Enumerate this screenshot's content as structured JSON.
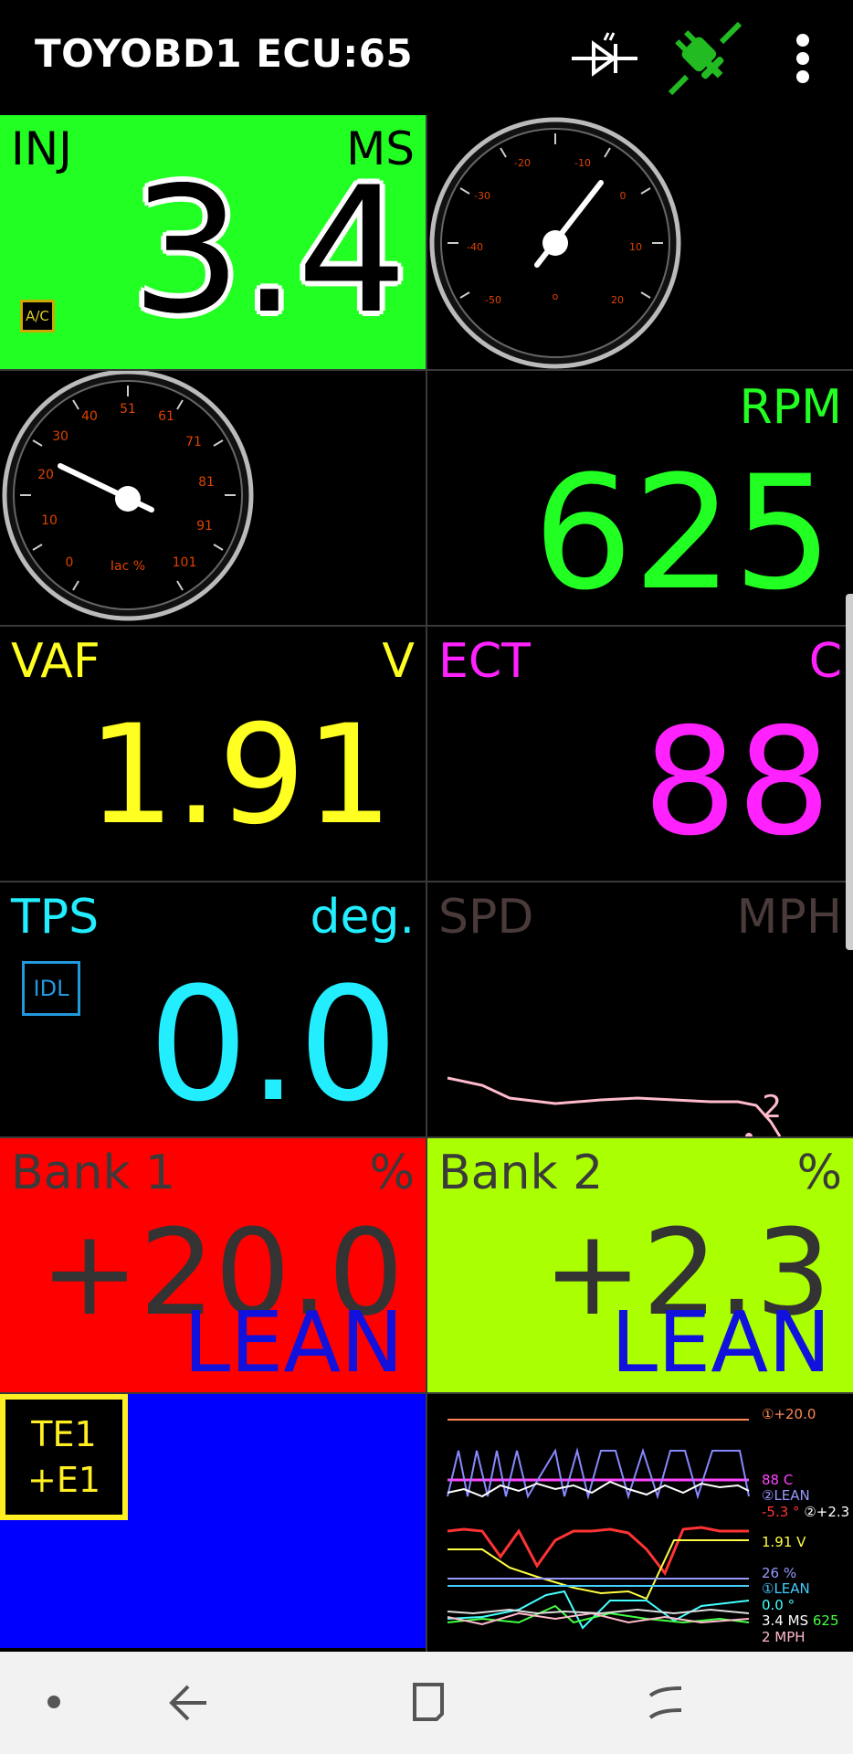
{
  "app": {
    "title": "TOYOBD1 ECU:65"
  },
  "toolbar": {
    "icons": [
      "diode-icon",
      "plug-connected-icon",
      "more-vert-icon"
    ]
  },
  "inj": {
    "label": "INJ",
    "unit": "MS",
    "value": "3.4",
    "badge": "A/C"
  },
  "gauge_ign": {
    "ticks": [
      "-20",
      "-10",
      "0",
      "10",
      "20",
      "-30",
      "-40",
      "-50"
    ],
    "center_mark": "o"
  },
  "gauge_iac": {
    "ticks": [
      "0",
      "10",
      "20",
      "30",
      "40",
      "51",
      "61",
      "71",
      "81",
      "91",
      "101"
    ],
    "label": "Iac %"
  },
  "rpm": {
    "label": "RPM",
    "value": "625"
  },
  "vaf": {
    "label": "VAF",
    "unit": "V",
    "value": "1.91"
  },
  "ect": {
    "label": "ECT",
    "unit": "C",
    "value": "88"
  },
  "tps": {
    "label": "TPS",
    "unit": "deg.",
    "value": "0.0",
    "badge": "IDL"
  },
  "spd": {
    "label": "SPD",
    "unit": "MPH",
    "value": "2"
  },
  "bank1": {
    "label": "Bank 1",
    "unit": "%",
    "value": "+20.0",
    "status": "LEAN"
  },
  "bank2": {
    "label": "Bank 2",
    "unit": "%",
    "value": "+2.3",
    "status": "LEAN"
  },
  "te1": {
    "line1": "TE1",
    "line2": "+E1"
  },
  "legend": {
    "items": [
      {
        "text": "①+20.0",
        "color": "#ff8855"
      },
      {
        "text": "88  C",
        "color": "#ff44ff"
      },
      {
        "text": "②LEAN",
        "color": "#9999ff"
      },
      {
        "text": "-5.3 °",
        "color": "#ff3333"
      },
      {
        "text": "②+2.3",
        "color": "#ffffff"
      },
      {
        "text": "1.91  V",
        "color": "#ffff44"
      },
      {
        "text": "26 %",
        "color": "#9999ff"
      },
      {
        "text": "①LEAN",
        "color": "#44ccff"
      },
      {
        "text": "0.0 °",
        "color": "#44ffff"
      },
      {
        "text": "3.4 MS",
        "color": "#ffffff"
      },
      {
        "text": "625",
        "color": "#44ff44"
      },
      {
        "text": "2  MPH",
        "color": "#ffbbcc"
      }
    ]
  },
  "colors": {
    "green": "#22ff22",
    "yellow": "#ffff22",
    "magenta": "#ff22ff",
    "cyan": "#22eeff",
    "red": "#ff0000",
    "lime": "#aaff00",
    "blue": "#0000ff"
  }
}
